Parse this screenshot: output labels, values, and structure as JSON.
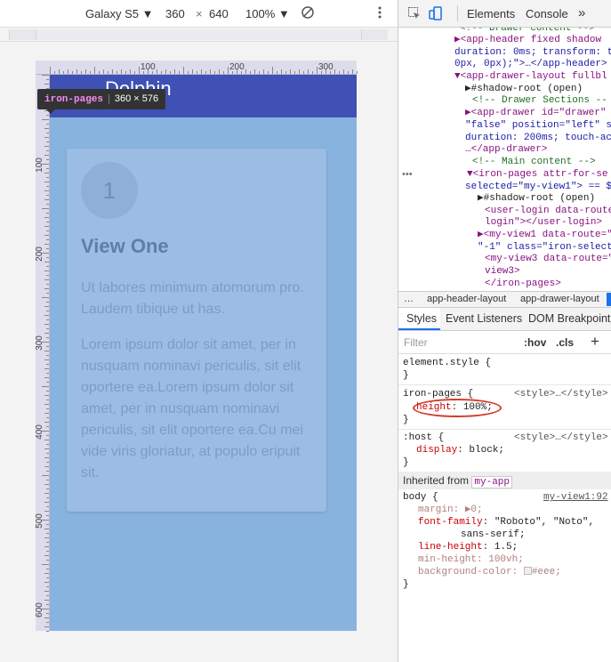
{
  "device_toolbar": {
    "device": "Galaxy S5",
    "width": "360",
    "times": "×",
    "height": "640",
    "zoom": "100%"
  },
  "ruler": {
    "top_labels": [
      "100",
      "200",
      "300"
    ],
    "left_labels": [
      "100",
      "200",
      "300",
      "400",
      "500",
      "600"
    ]
  },
  "app": {
    "title": "Dolphin",
    "circle_number": "1",
    "view_title": "View One",
    "para1": "Ut labores minimum atomorum pro. Laudem tibique ut has.",
    "para2": "Lorem ipsum dolor sit amet, per in nusquam nominavi periculis, sit elit oportere ea.Lorem ipsum dolor sit amet, per in nusquam nominavi periculis, sit elit oportere ea.Cu mei vide viris gloriatur, at populo eripuit sit."
  },
  "tooltip": {
    "tag": "iron-pages",
    "size": "360 × 576"
  },
  "devtools": {
    "tabs": {
      "elements": "Elements",
      "console": "Console",
      "more": "»"
    },
    "dom_lines": [
      [
        "<!-- Drawer content -->",
        "cm"
      ],
      [
        "▶<app-header fixed shadow",
        "tg"
      ],
      [
        "duration: 0ms; transform: t",
        "av"
      ],
      [
        "0px, 0px);\">…</app-header>",
        "av"
      ],
      [
        "▼<app-drawer-layout fullbl",
        "tg"
      ],
      [
        "▶#shadow-root (open)",
        "tx"
      ],
      [
        "<!-- Drawer Sections --",
        "cm"
      ],
      [
        "▶<app-drawer id=\"drawer\"",
        "tg"
      ],
      [
        "\"false\" position=\"left\" s",
        "av"
      ],
      [
        "duration: 200ms; touch-ac",
        "av"
      ],
      [
        "…</app-drawer>",
        "tg"
      ],
      [
        "<!-- Main content -->",
        "cm"
      ],
      [
        "▼<iron-pages attr-for-se",
        "tg"
      ],
      [
        "selected=\"my-view1\"> == $",
        "av"
      ],
      [
        "▶#shadow-root (open)",
        "tx"
      ],
      [
        "<user-login data-route",
        "tg"
      ],
      [
        "login\"></user-login>",
        "tg"
      ],
      [
        "▶<my-view1 data-route=\"",
        "tg"
      ],
      [
        "\"-1\" class=\"iron-select",
        "av"
      ],
      [
        "<my-view3 data-route=\"",
        "tg"
      ],
      [
        "view3>",
        "tg"
      ],
      [
        "</iron-pages>",
        "tg"
      ]
    ],
    "breadcrumbs": [
      "…",
      "app-header-layout",
      "app-drawer-layout"
    ],
    "style_tabs": [
      "Styles",
      "Event Listeners",
      "DOM Breakpoints"
    ],
    "filter_placeholder": "Filter",
    "hov": ":hov",
    "cls": ".cls",
    "plus": "+",
    "rules": {
      "element_style": "element.style {",
      "close": "}",
      "iron_sel": "iron-pages {",
      "iron_src": "<style>…</style>",
      "iron_prop": "height",
      "iron_val": "100%;",
      "host_sel": ":host {",
      "host_src": "<style>…</style>",
      "host_prop": "display",
      "host_val": "block;",
      "inherited_label": "Inherited from",
      "inherited_from": "my-app",
      "body_sel": "body {",
      "body_src": "my-view1:92",
      "margin_prop": "margin",
      "margin_val": "▶0;",
      "ff_prop": "font-family",
      "ff_val": "\"Roboto\", \"Noto\",",
      "ff_val2": "sans-serif;",
      "lh_prop": "line-height",
      "lh_val": "1.5;",
      "mh_prop": "min-height",
      "mh_val": "100vh;",
      "bg_prop": "background-color",
      "bg_val": "#eee;"
    }
  }
}
